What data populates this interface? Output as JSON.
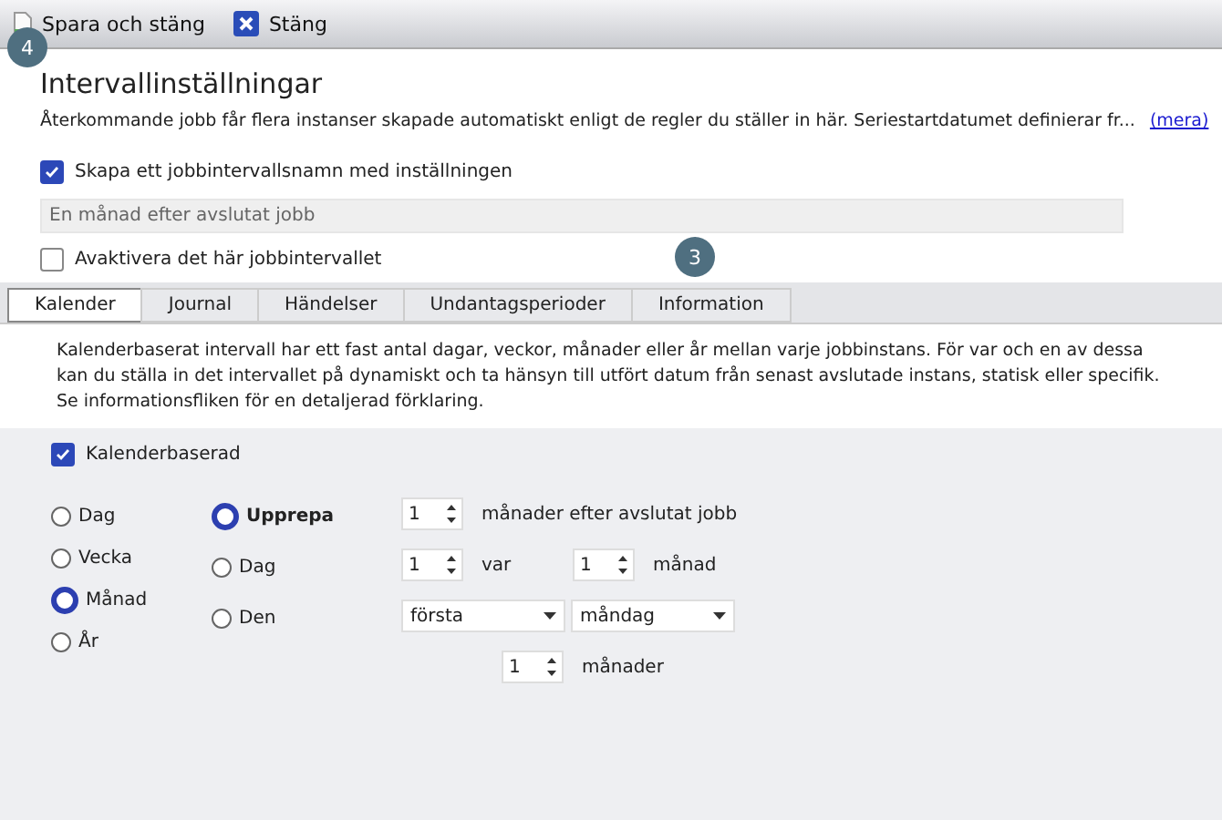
{
  "toolbar": {
    "buttons": [
      {
        "kind": "save",
        "label": "Spara och stäng"
      },
      {
        "kind": "close",
        "label": "Stäng"
      }
    ]
  },
  "callouts": [
    {
      "label": "4"
    },
    {
      "label": "3"
    }
  ],
  "header": {
    "title": "Intervallinställningar",
    "description": "Återkommande jobb får flera instanser skapade automatiskt enligt de regler du ställer in här. Seriestartdatumet definierar fr...",
    "more_link": "(mera)"
  },
  "create_name": {
    "label": "Skapa ett jobbintervallsnamn med inställningen",
    "checked": true
  },
  "name_field": {
    "value": "En månad efter avslutat jobb"
  },
  "deactivate": {
    "label": "Avaktivera det här jobbintervallet",
    "checked": false
  },
  "tabs": [
    {
      "label": "Kalender",
      "selected": true
    },
    {
      "label": "Journal",
      "selected": false
    },
    {
      "label": "Händelser",
      "selected": false
    },
    {
      "label": "Undantagsperioder",
      "selected": false
    },
    {
      "label": "Information",
      "selected": false
    }
  ],
  "info_text": "Kalenderbaserat intervall har ett fast antal dagar, veckor, månader eller år mellan varje jobbinstans. För var och en av dessa kan du ställa in det intervallet på dynamiskt och ta hänsyn till utfört datum från senast avslutade instans, statisk eller specifik. Se informationsfliken för en detaljerad förklaring.",
  "calendar_based": {
    "label": "Kalenderbaserad",
    "checked": true
  },
  "period": [
    {
      "label": "Dag",
      "selected": false
    },
    {
      "label": "Vecka",
      "selected": false
    },
    {
      "label": "Månad",
      "selected": true
    },
    {
      "label": "År",
      "selected": false
    }
  ],
  "mode": [
    {
      "label": "Upprepa",
      "selected": true
    },
    {
      "label": "Dag",
      "selected": false
    },
    {
      "label": "Den",
      "selected": false
    }
  ],
  "repeat_row": {
    "count": "1",
    "suffix": "månader efter avslutat jobb"
  },
  "day_row": {
    "day": "1",
    "middle": "var",
    "months": "1",
    "suffix": "månad"
  },
  "den_row": {
    "ordinal": "första",
    "weekday": "måndag",
    "count": "1",
    "suffix": "månader"
  }
}
